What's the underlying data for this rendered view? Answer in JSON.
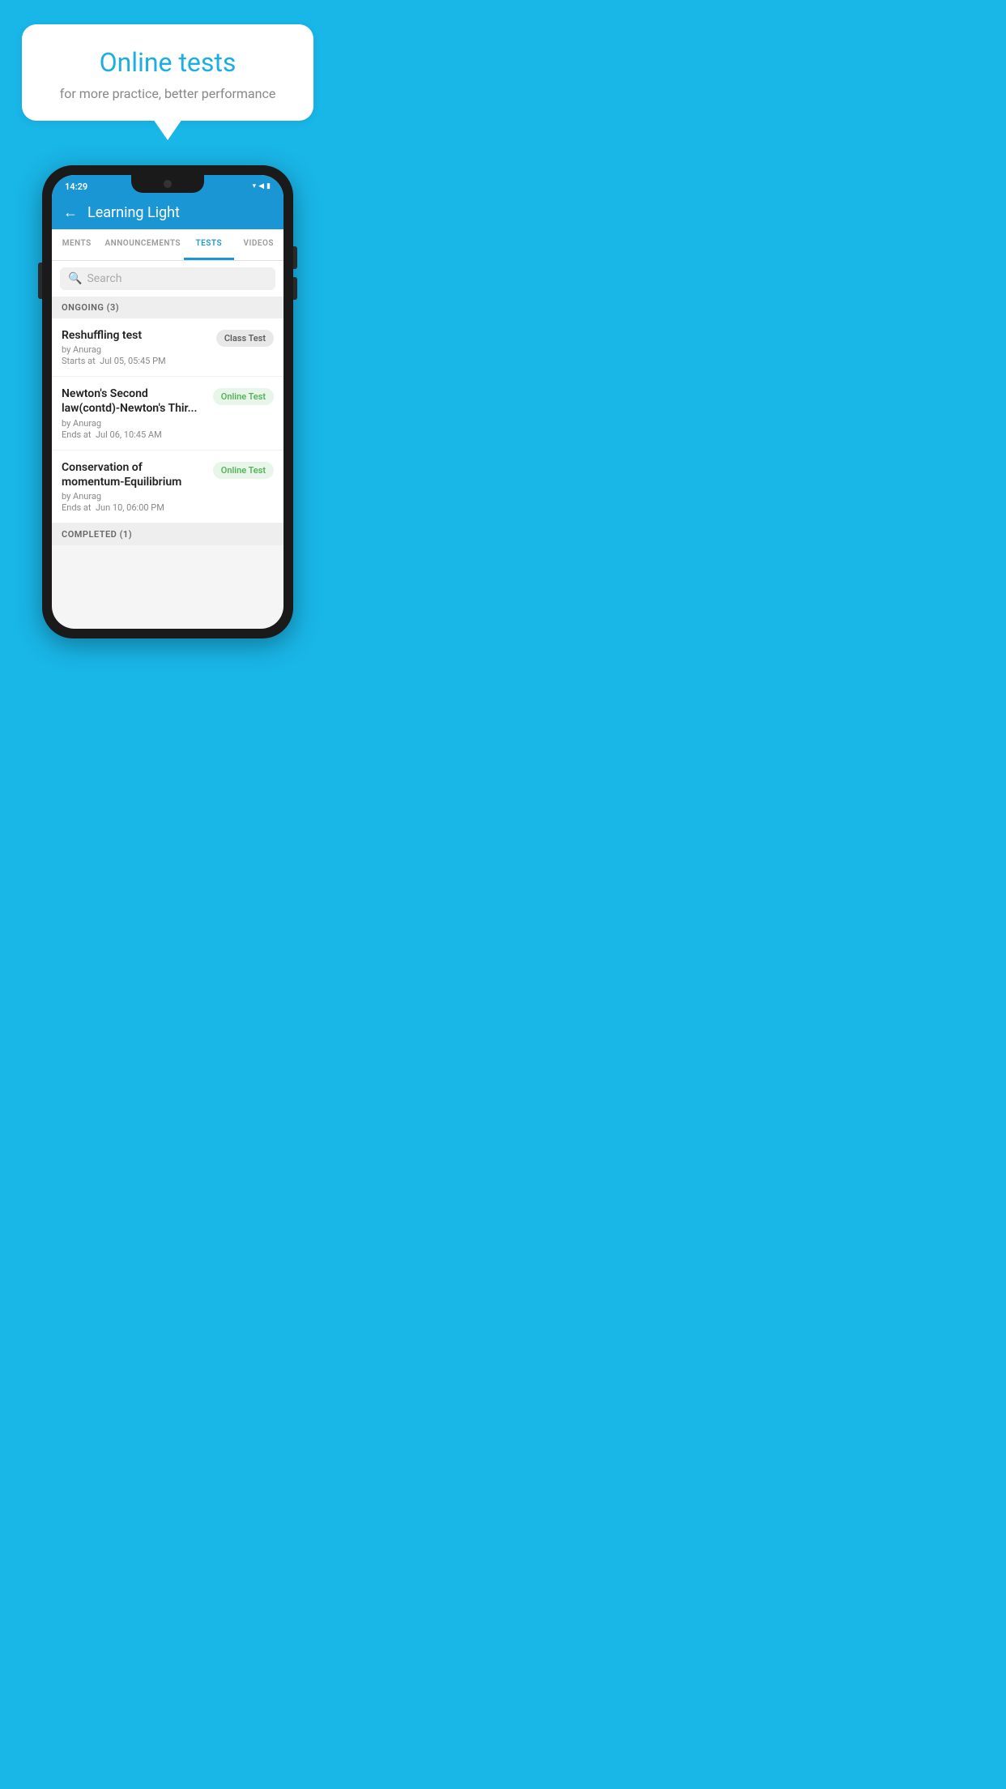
{
  "background": {
    "color": "#19b6e8"
  },
  "hero": {
    "bubble_title": "Online tests",
    "bubble_subtitle": "for more practice, better performance"
  },
  "phone": {
    "status_bar": {
      "time": "14:29",
      "icons": [
        "wifi",
        "signal",
        "battery"
      ]
    },
    "header": {
      "back_label": "←",
      "title": "Learning Light"
    },
    "tabs": [
      {
        "label": "MENTS",
        "active": false
      },
      {
        "label": "ANNOUNCEMENTS",
        "active": false
      },
      {
        "label": "TESTS",
        "active": true
      },
      {
        "label": "VIDEOS",
        "active": false
      }
    ],
    "search": {
      "placeholder": "Search"
    },
    "ongoing_section": {
      "label": "ONGOING (3)"
    },
    "test_items": [
      {
        "name": "Reshuffling test",
        "by": "by Anurag",
        "date": "Starts at  Jul 05, 05:45 PM",
        "badge": "Class Test",
        "badge_type": "class"
      },
      {
        "name": "Newton's Second law(contd)-Newton's Thir...",
        "by": "by Anurag",
        "date": "Ends at  Jul 06, 10:45 AM",
        "badge": "Online Test",
        "badge_type": "online"
      },
      {
        "name": "Conservation of momentum-Equilibrium",
        "by": "by Anurag",
        "date": "Ends at  Jun 10, 06:00 PM",
        "badge": "Online Test",
        "badge_type": "online"
      }
    ],
    "completed_section": {
      "label": "COMPLETED (1)"
    }
  }
}
